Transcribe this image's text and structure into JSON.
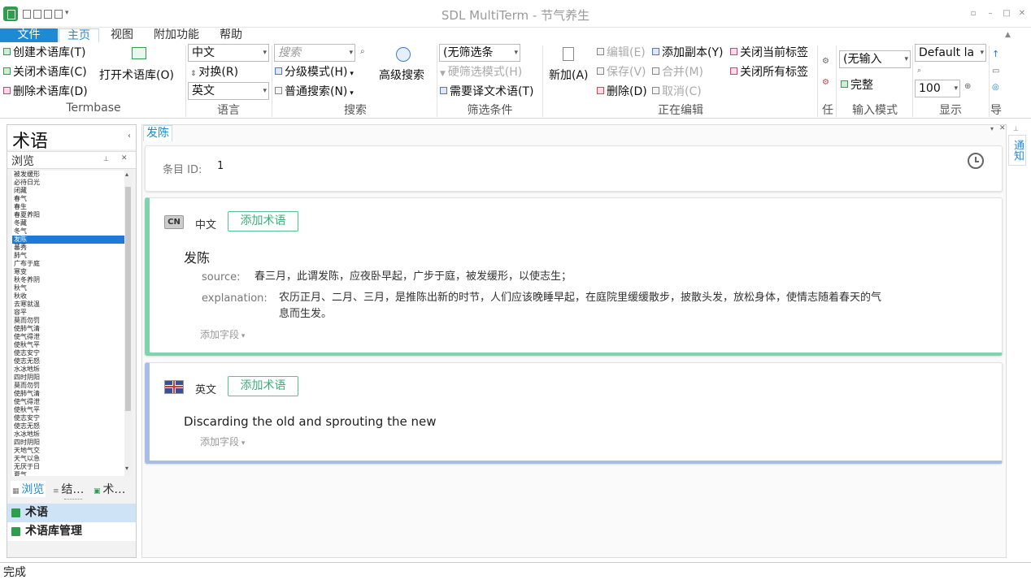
{
  "window": {
    "title": "SDL MultiTerm - 节气养生"
  },
  "menu": {
    "tabs": [
      "文件",
      "主页",
      "视图",
      "附加功能",
      "帮助"
    ]
  },
  "ribbon": {
    "termbase": {
      "create": "创建术语库(T)",
      "close": "关闭术语库(C)",
      "delete": "删除术语库(D)",
      "open": "打开术语库(O)",
      "label": "Termbase"
    },
    "language": {
      "source": "中文",
      "swap": "对换(R)",
      "target": "英文",
      "label": "语言"
    },
    "search": {
      "placeholder": "搜索",
      "hierarchical": "分级模式(H)",
      "normal": "普通搜索(N)",
      "advanced": "高级搜索",
      "label": "搜索"
    },
    "filter": {
      "value": "(无筛选条",
      "hard": "硬筛选模式(H)",
      "need": "需要译文术语(T)",
      "label": "筛选条件"
    },
    "editing": {
      "new": "新加(A)",
      "edit": "编辑(E)",
      "save": "保存(V)",
      "delete": "删除(D)",
      "add_copy": "添加副本(Y)",
      "merge": "合并(M)",
      "cancel": "取消(C)",
      "close_tab": "关闭当前标签",
      "close_all": "关闭所有标签",
      "label": "正在编辑"
    },
    "task": {
      "label": "任"
    },
    "input": {
      "value": "(无输入",
      "full": "完整",
      "label": "输入模式"
    },
    "display": {
      "layout": "Default la",
      "zoom": "100",
      "label": "显示"
    },
    "nav": {
      "label": "导"
    }
  },
  "left_panel": {
    "title": "术语",
    "browse_title": "浏览",
    "terms": [
      "被发缓形",
      "必待日光",
      "闭藏",
      "春气",
      "春生",
      "春夏养阳",
      "冬藏",
      "冬气",
      "发陈",
      "蕃秀",
      "肺气",
      "广布于庭",
      "寒变",
      "秋冬养阴",
      "秋气",
      "秋收",
      "去寒就温",
      "容平",
      "莫而勿罚",
      "使肺气清",
      "使气得泄",
      "使秋气平",
      "使志安宁",
      "使志无怒",
      "水冰地坼",
      "四时阴阳",
      "莫而勿罚",
      "使肺气清",
      "使气得泄",
      "使秋气平",
      "使志安宁",
      "使志无怒",
      "水冰地坼",
      "四时阴阳",
      "天地气交",
      "天气以急",
      "无厌于日",
      "夏气"
    ],
    "selected_index": 8,
    "tabs": [
      "浏览",
      "结…",
      "术…"
    ],
    "nav_items": [
      "术语",
      "术语库管理"
    ]
  },
  "document": {
    "tab": "发陈",
    "entry_label": "条目 ID:",
    "entry_id": "1",
    "cn": {
      "badge": "CN",
      "language": "中文",
      "add_term": "添加术语",
      "term": "发陈",
      "source_label": "source:",
      "source": "春三月，此谓发陈，应夜卧早起，广步于庭，被发缓形，以使志生；",
      "explanation_label": "explanation:",
      "explanation_line1": "农历正月、二月、三月，是推陈出新的时节，人们应该晚睡早起，在庭院里缓缓散步，披散头发，放松身体，使情志随着春天的气",
      "explanation_line2": "息而生发。",
      "add_field": "添加字段"
    },
    "en": {
      "language": "英文",
      "add_term": "添加术语",
      "term": "Discarding the old and sprouting the new",
      "add_field": "添加字段"
    }
  },
  "notifications": {
    "label": "通知"
  },
  "status": {
    "text": "完成"
  }
}
